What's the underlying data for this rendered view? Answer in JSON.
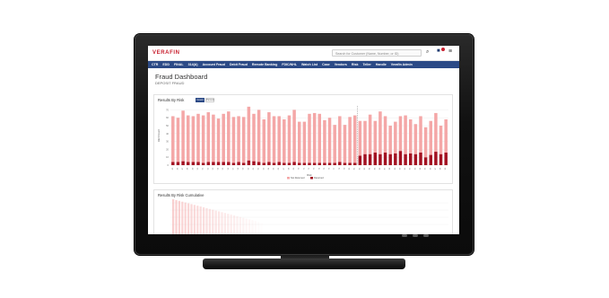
{
  "app": {
    "logo_text": "VERAFIN",
    "search_placeholder": "Search for Customer (Name, Number, or ID)",
    "nav": [
      "CTR",
      "EDD",
      "FINAL",
      "314(A)",
      "Account Fraud",
      "Debit Fraud",
      "Remote Banking",
      "FDIC/NHL",
      "Watch List",
      "Case",
      "Vendors",
      "Risk",
      "Teller",
      "Handle",
      "Verafin Admin"
    ]
  },
  "page": {
    "title": "Fraud Dashboard",
    "subtitle": "DEPOSIT FRAUD"
  },
  "results_by_risk": {
    "title": "Results By Risk",
    "toggle_active": "Count",
    "toggle_inactive": "Percent"
  },
  "results_by_risk_cumulative": {
    "title": "Results By Risk Cumulative"
  },
  "colors": {
    "not_returned": "#f4a7a7",
    "returned": "#a31222",
    "nav_bg": "#2c4a86",
    "brand": "#c8202f"
  },
  "chart_data": {
    "type": "bar",
    "stacked": true,
    "ylabel": "Alert Count",
    "xlabel": "Risk",
    "ylim": [
      0,
      75
    ],
    "y_ticks": [
      0,
      10,
      20,
      30,
      40,
      50,
      60,
      70
    ],
    "categories": [
      "45",
      "46",
      "47",
      "48",
      "49",
      "50",
      "51",
      "52",
      "53",
      "54",
      "55",
      "56",
      "57",
      "58",
      "59",
      "60",
      "61",
      "62",
      "63",
      "64",
      "65",
      "66",
      "67",
      "68",
      "69",
      "70",
      "71",
      "72",
      "73",
      "74",
      "75",
      "76",
      "77",
      "78",
      "79",
      "80",
      "81",
      "82",
      "83",
      "84",
      "85",
      "86",
      "87",
      "88",
      "89",
      "90",
      "91",
      "92",
      "93",
      "94",
      "95",
      "96",
      "97",
      "98",
      "99"
    ],
    "series": [
      {
        "name": "Not Returned",
        "values": [
          58,
          56,
          64,
          59,
          58,
          61,
          60,
          63,
          60,
          55,
          61,
          64,
          58,
          58,
          58,
          68,
          60,
          66,
          55,
          63,
          59,
          58,
          55,
          60,
          66,
          52,
          52,
          62,
          63,
          62,
          54,
          57,
          48,
          58,
          48,
          58,
          60,
          44,
          42,
          50,
          40,
          54,
          46,
          36,
          40,
          44,
          49,
          43,
          38,
          46,
          38,
          43,
          49,
          36,
          42
        ]
      },
      {
        "name": "Returned",
        "values": [
          4,
          4,
          5,
          4,
          4,
          4,
          3,
          4,
          4,
          4,
          4,
          4,
          3,
          4,
          3,
          6,
          5,
          4,
          3,
          4,
          3,
          4,
          3,
          3,
          4,
          3,
          3,
          3,
          3,
          3,
          3,
          3,
          3,
          4,
          3,
          3,
          3,
          12,
          14,
          14,
          16,
          14,
          16,
          14,
          15,
          18,
          14,
          15,
          14,
          16,
          10,
          13,
          17,
          14,
          16
        ]
      }
    ],
    "legend": [
      "Not Returned",
      "Returned"
    ],
    "legend_position": "bottom",
    "grid": true
  }
}
